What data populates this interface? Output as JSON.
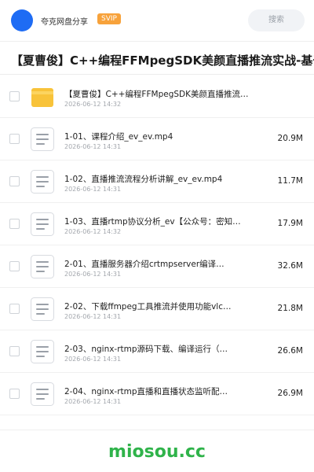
{
  "header": {
    "brand": "夸克网盘分享",
    "badge": "SVIP",
    "search_placeholder": "搜索"
  },
  "title": "【夏曹俊】C++编程FFMpegSDK美颜直播推流实战-基于qt",
  "files": [
    {
      "type": "folder",
      "name": "【夏曹俊】C++编程FFMpegSDK美颜直播推流…",
      "date": "2026-06-12 14:32",
      "size": ""
    },
    {
      "type": "file",
      "name": "1-01、课程介绍_ev_ev.mp4",
      "date": "2026-06-12 14:31",
      "size": "20.9M"
    },
    {
      "type": "file",
      "name": "1-02、直播推流流程分析讲解_ev_ev.mp4",
      "date": "2026-06-12 14:31",
      "size": "11.7M"
    },
    {
      "type": "file",
      "name": "1-03、直播rtmp协议分析_ev【公众号：密知…",
      "date": "2026-06-12 14:32",
      "size": "17.9M"
    },
    {
      "type": "file",
      "name": "2-01、直播服务器介绍crtmpserver编译…",
      "date": "2026-06-12 14:31",
      "size": "32.6M"
    },
    {
      "type": "file",
      "name": "2-02、下载ffmpeg工具推流并使用功能vlc…",
      "date": "2026-06-12 14:31",
      "size": "21.8M"
    },
    {
      "type": "file",
      "name": "2-03、nginx-rtmp源码下载、编译运行（…",
      "date": "2026-06-12 14:31",
      "size": "26.6M"
    },
    {
      "type": "file",
      "name": "2-04、nginx-rtmp直播和直播状态监听配…",
      "date": "2026-06-12 14:31",
      "size": "26.9M"
    }
  ],
  "watermark": "miosou.cc",
  "colors": {
    "accent": "#1e6cf4",
    "svip": "#f7a23b",
    "folder": "#f8c33a",
    "watermark": "#2fb34a"
  }
}
